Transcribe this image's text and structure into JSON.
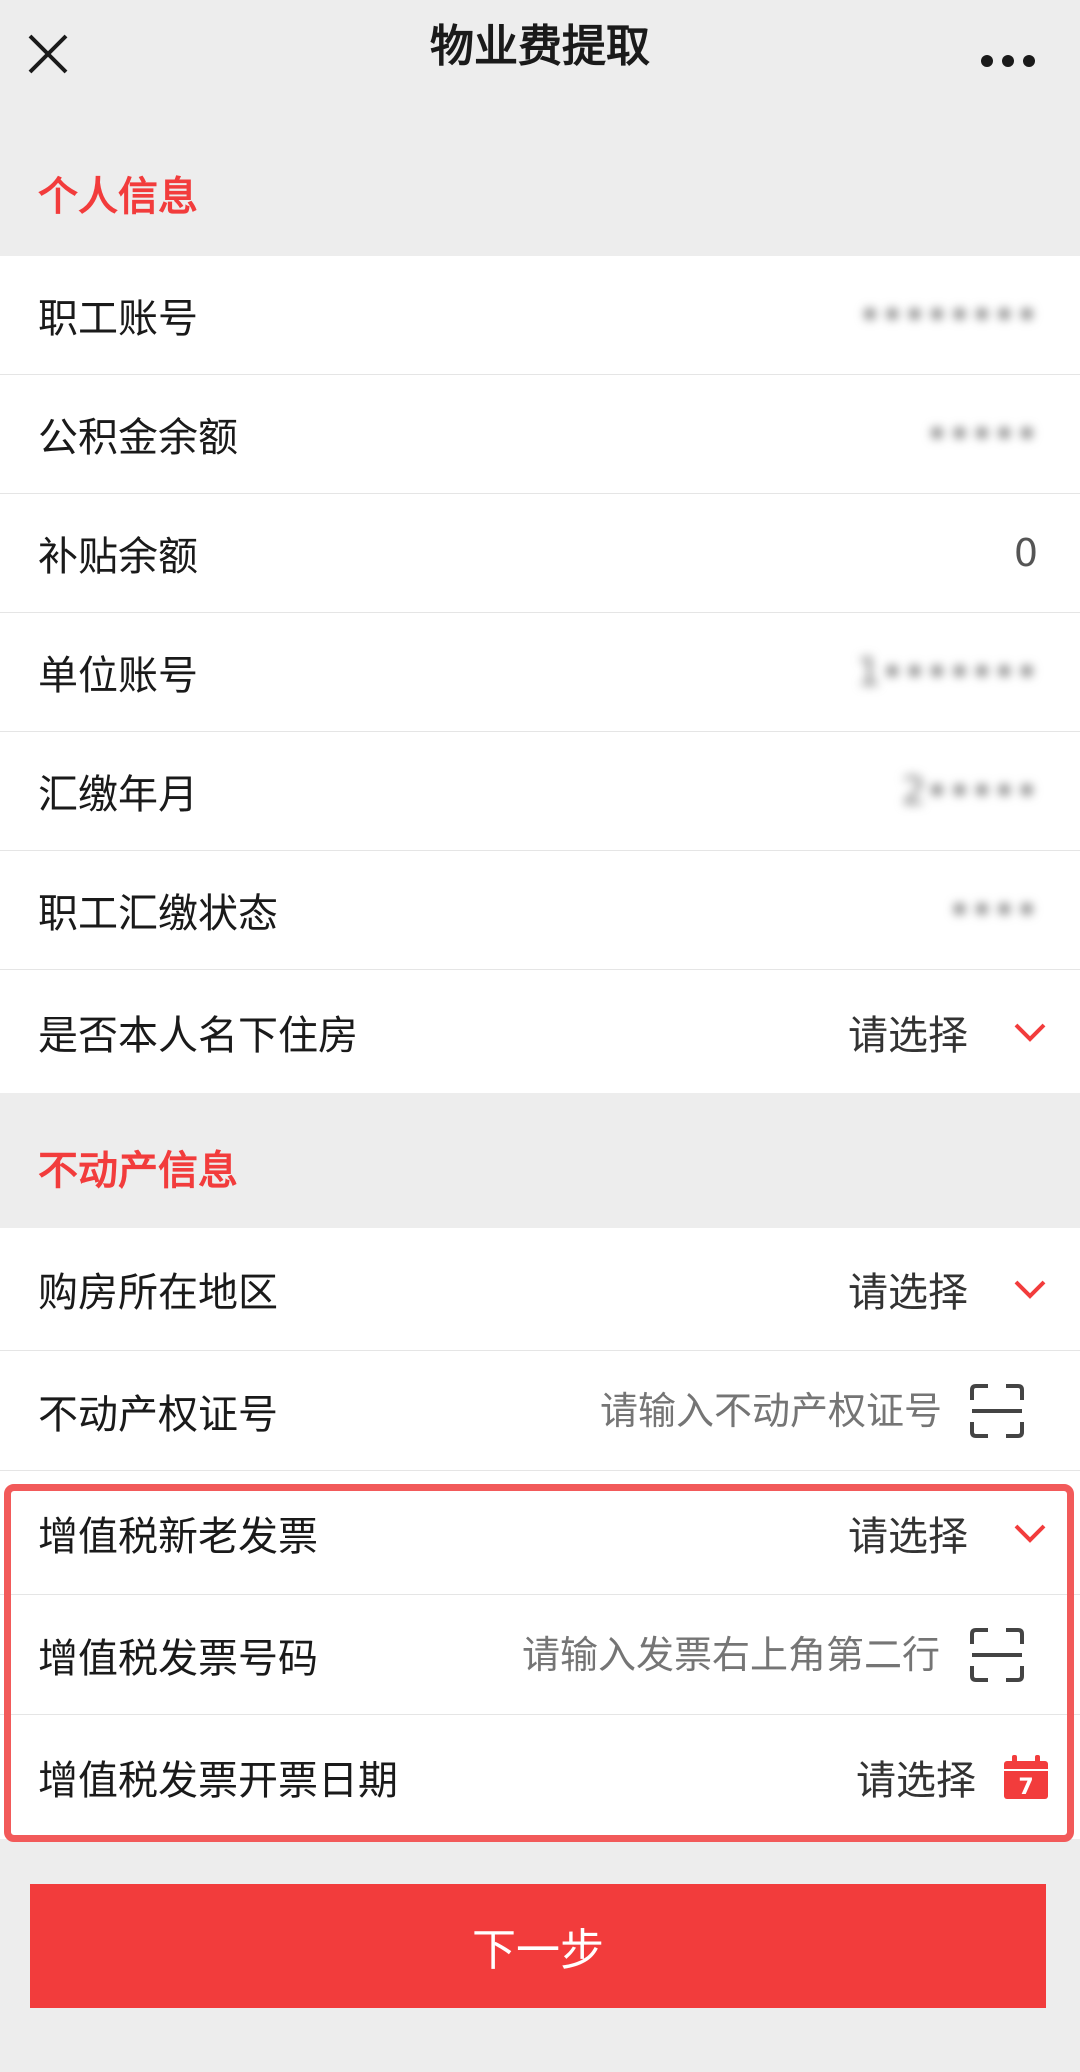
{
  "nav": {
    "title": "物业费提取",
    "close_icon": "close-icon",
    "more_icon": "more-icon"
  },
  "colors": {
    "accent": "#f23c3c",
    "background": "#ededed",
    "highlight": "#f25a5a"
  },
  "personal": {
    "section_title": "个人信息",
    "rows": [
      {
        "label": "职工账号",
        "value": "••••••••"
      },
      {
        "label": "公积金余额",
        "value": "•••••"
      },
      {
        "label": "补贴余额",
        "value": "0"
      },
      {
        "label": "单位账号",
        "value": "1•••••••"
      },
      {
        "label": "汇缴年月",
        "value": "2•••••"
      },
      {
        "label": "职工汇缴状态",
        "value": "••••"
      },
      {
        "label": "是否本人名下住房",
        "select": "请选择"
      }
    ]
  },
  "property": {
    "section_title": "不动产信息",
    "region": {
      "label": "购房所在地区",
      "select": "请选择"
    },
    "certificate": {
      "label": "不动产权证号",
      "placeholder": "请输入不动产权证号"
    },
    "vat_invoice_type": {
      "label": "增值税新老发票",
      "select": "请选择"
    },
    "vat_invoice_number": {
      "label": "增值税发票号码",
      "placeholder": "请输入发票右上角第二行"
    },
    "vat_invoice_date": {
      "label": "增值税发票开票日期",
      "select": "请选择",
      "calendar_day": "7"
    }
  },
  "actions": {
    "next_label": "下一步"
  }
}
